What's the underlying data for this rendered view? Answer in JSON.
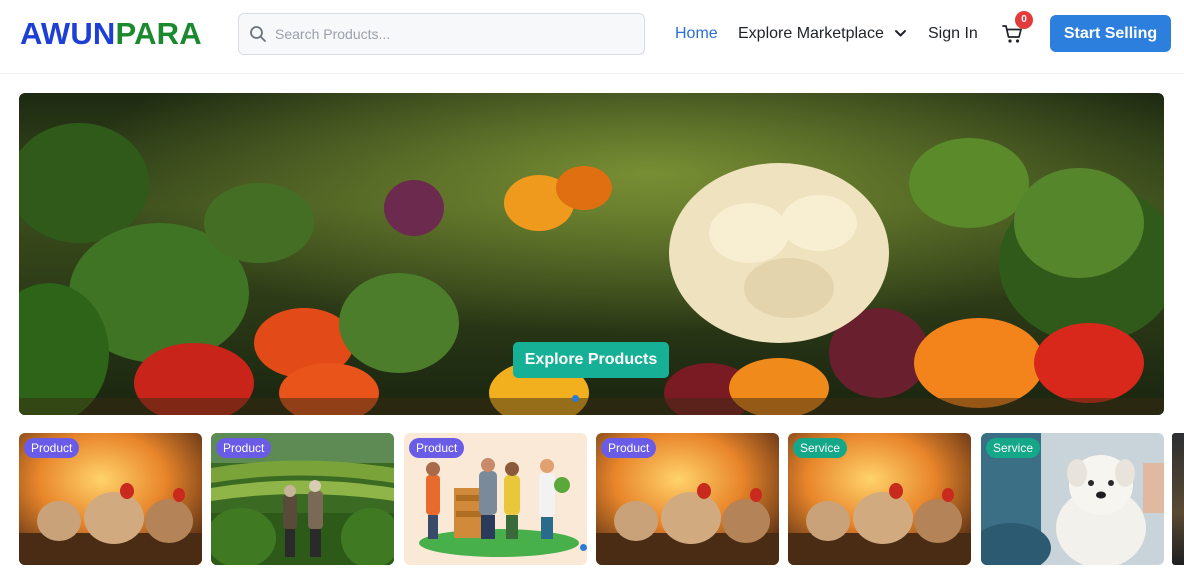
{
  "header": {
    "logo_part1": "AWUN",
    "logo_part2": "PARA",
    "search_placeholder": "Search Products...",
    "nav": {
      "home": "Home",
      "explore": "Explore Marketplace",
      "sign_in": "Sign In"
    },
    "cart_count": "0",
    "start_selling": "Start Selling",
    "colors": {
      "brand_blue": "#1d3fd6",
      "brand_green": "#1b8a2e",
      "link_active": "#2b6fd6",
      "primary_button": "#2c7fdc"
    }
  },
  "hero": {
    "button_label": "Explore Products",
    "button_color": "#16b096",
    "image_subject": "vegetables-field"
  },
  "cards": [
    {
      "tag": "Product",
      "image": "chickens-sunset"
    },
    {
      "tag": "Product",
      "image": "farmers-field"
    },
    {
      "tag": "Product",
      "image": "farmers-illustration"
    },
    {
      "tag": "Product",
      "image": "chickens-sunset"
    },
    {
      "tag": "Service",
      "image": "chickens-sunset"
    },
    {
      "tag": "Service",
      "image": "dog-grooming"
    }
  ]
}
